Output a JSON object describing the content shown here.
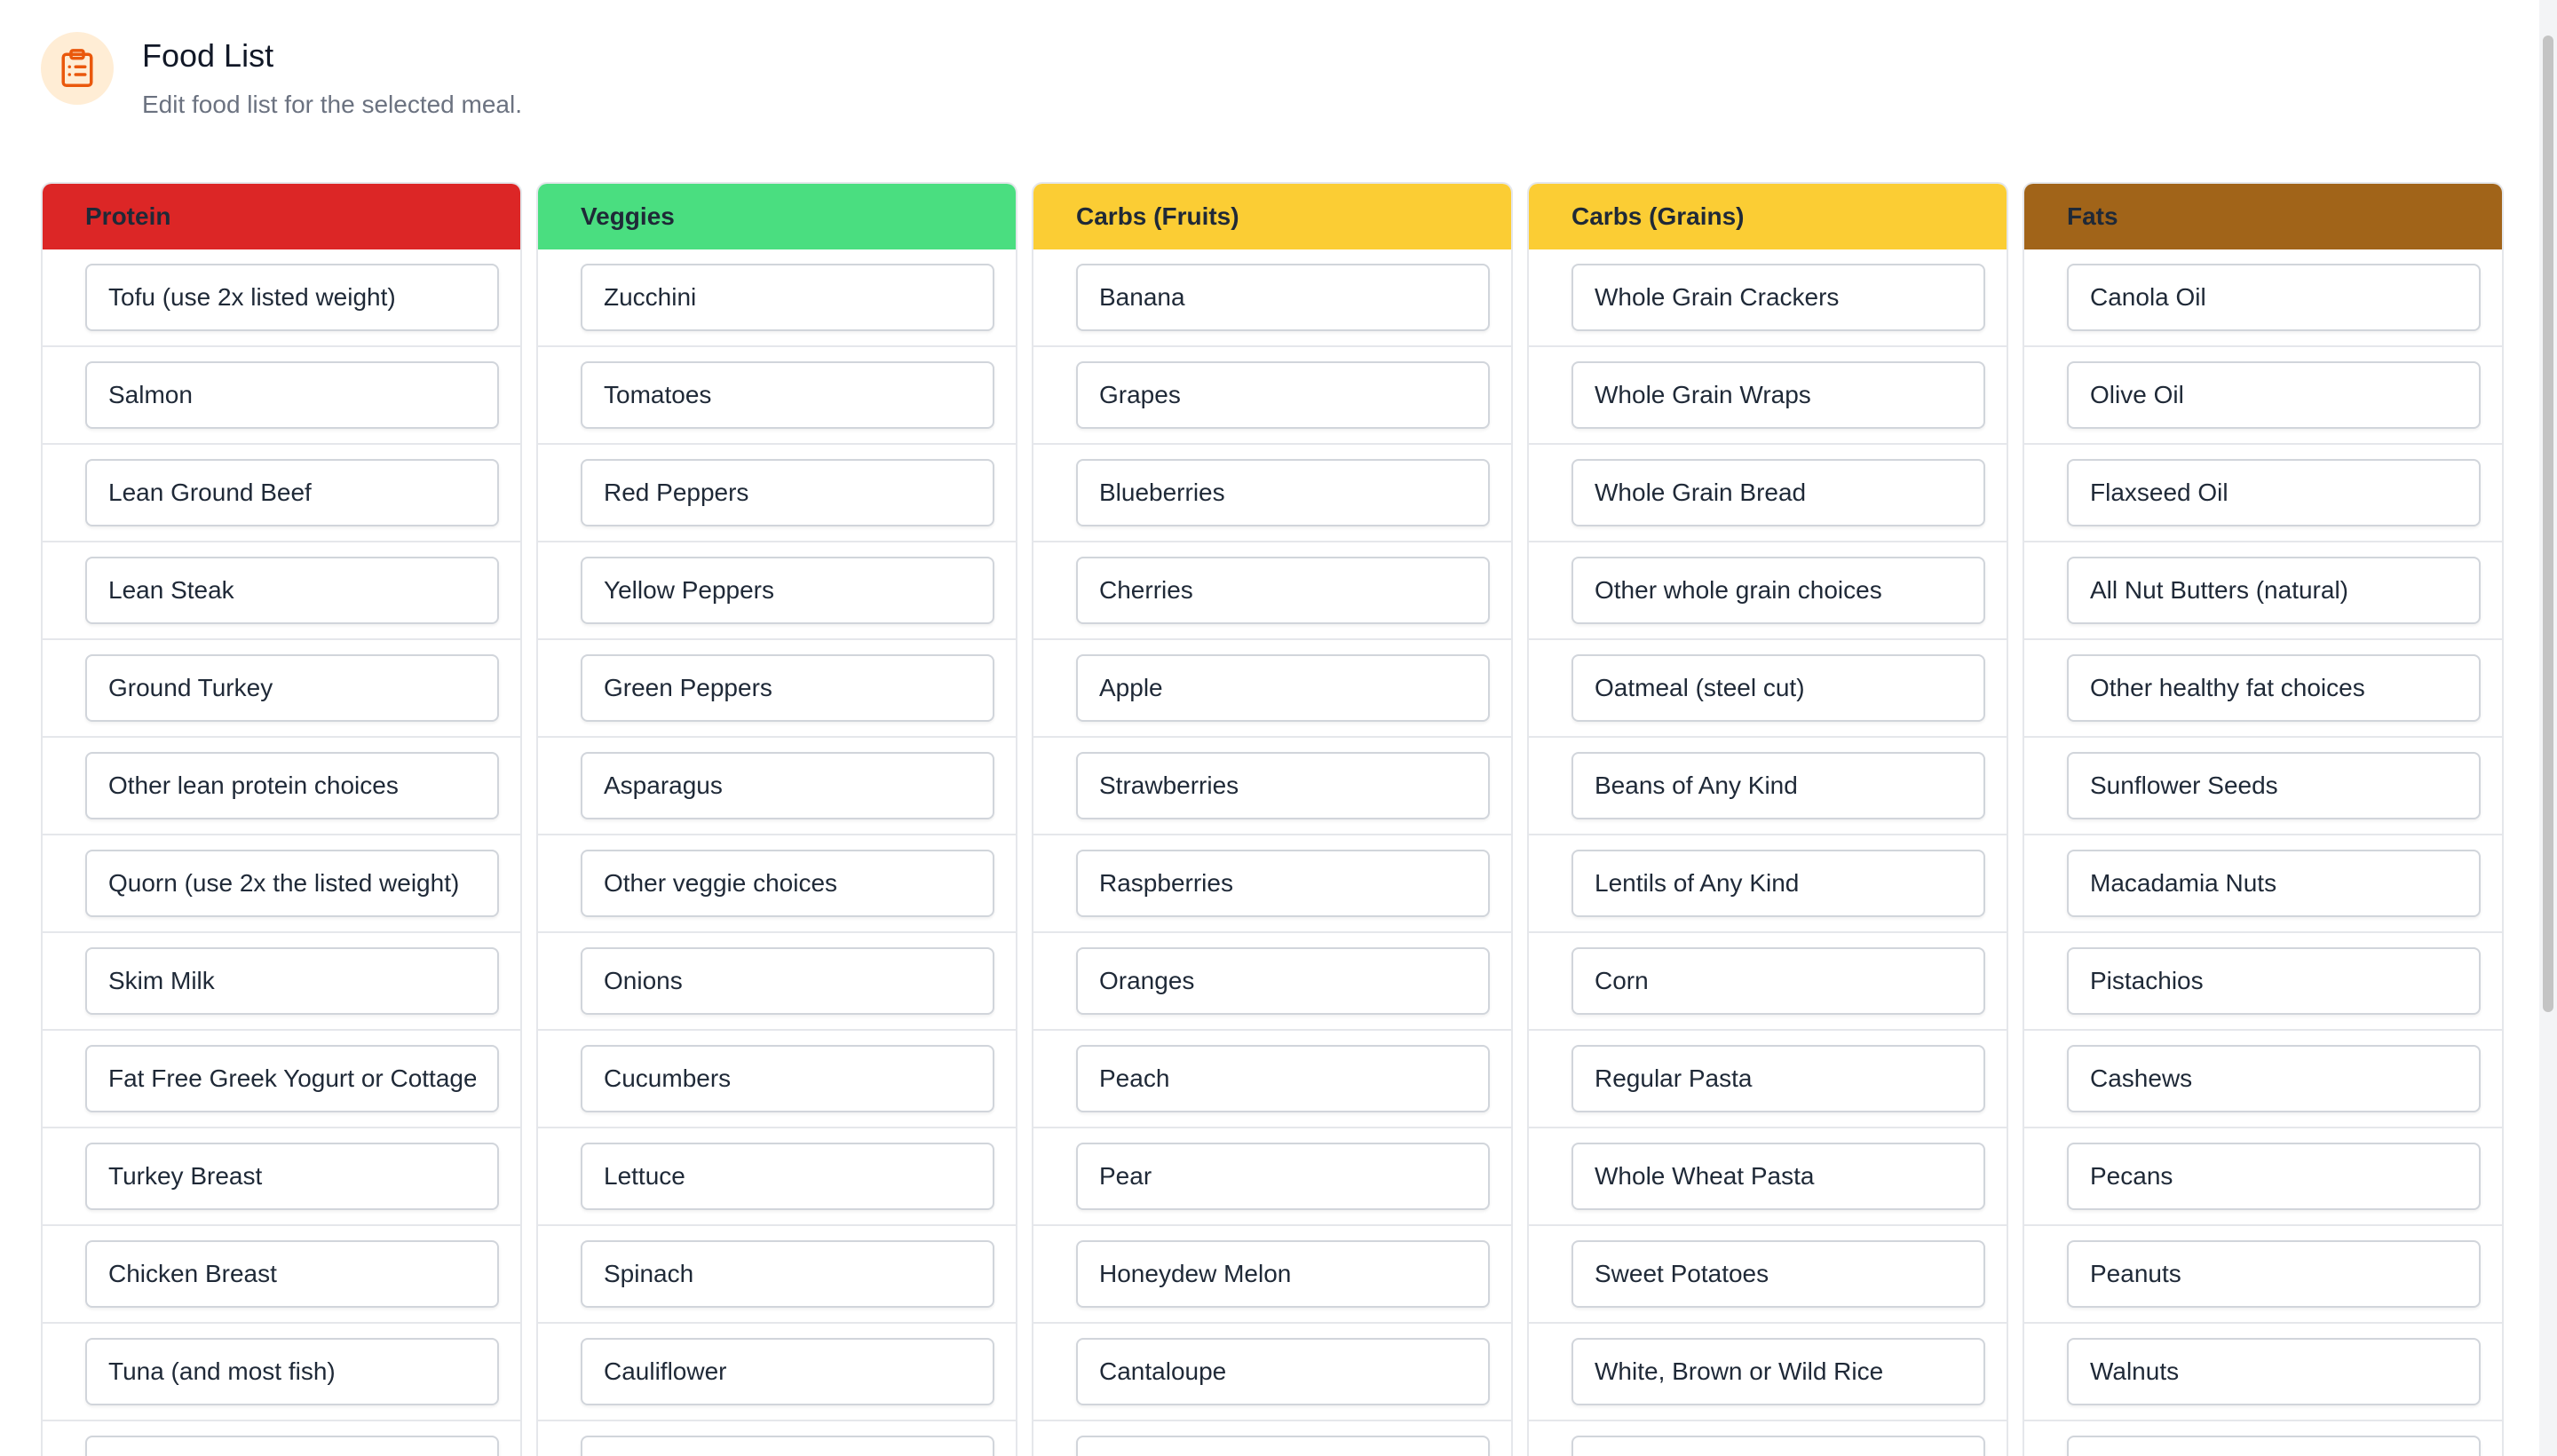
{
  "header": {
    "title": "Food List",
    "subtitle": "Edit food list for the selected meal.",
    "icon": "clipboard-list-icon",
    "icon_color": "#ea580c",
    "icon_bg": "#ffedd5"
  },
  "columns": [
    {
      "title": "Protein",
      "color": "#dc2626",
      "items": [
        "Tofu (use 2x listed weight)",
        "Salmon",
        "Lean Ground Beef",
        "Lean Steak",
        "Ground Turkey",
        "Other lean protein choices",
        "Quorn (use 2x the listed weight)",
        "Skim Milk",
        "Fat Free Greek Yogurt or Cottage",
        "Turkey Breast",
        "Chicken Breast",
        "Tuna (and most fish)",
        ""
      ]
    },
    {
      "title": "Veggies",
      "color": "#4ade80",
      "items": [
        "Zucchini",
        "Tomatoes",
        "Red Peppers",
        "Yellow Peppers",
        "Green Peppers",
        "Asparagus",
        "Other veggie choices",
        "Onions",
        "Cucumbers",
        "Lettuce",
        "Spinach",
        "Cauliflower",
        ""
      ]
    },
    {
      "title": "Carbs (Fruits)",
      "color": "#fbcd34",
      "items": [
        "Banana",
        "Grapes",
        "Blueberries",
        "Cherries",
        "Apple",
        "Strawberries",
        "Raspberries",
        "Oranges",
        "Peach",
        "Pear",
        "Honeydew Melon",
        "Cantaloupe",
        ""
      ]
    },
    {
      "title": "Carbs (Grains)",
      "color": "#fbcd34",
      "items": [
        "Whole Grain Crackers",
        "Whole Grain Wraps",
        "Whole Grain Bread",
        "Other whole grain choices",
        "Oatmeal (steel cut)",
        "Beans of Any Kind",
        "Lentils of Any Kind",
        "Corn",
        "Regular Pasta",
        "Whole Wheat Pasta",
        "Sweet Potatoes",
        "White, Brown or Wild Rice",
        ""
      ]
    },
    {
      "title": "Fats",
      "color": "#a16419",
      "items": [
        "Canola Oil",
        "Olive Oil",
        "Flaxseed Oil",
        "All Nut Butters (natural)",
        "Other healthy fat choices",
        "Sunflower Seeds",
        "Macadamia Nuts",
        "Pistachios",
        "Cashews",
        "Pecans",
        "Peanuts",
        "Walnuts",
        ""
      ]
    }
  ]
}
